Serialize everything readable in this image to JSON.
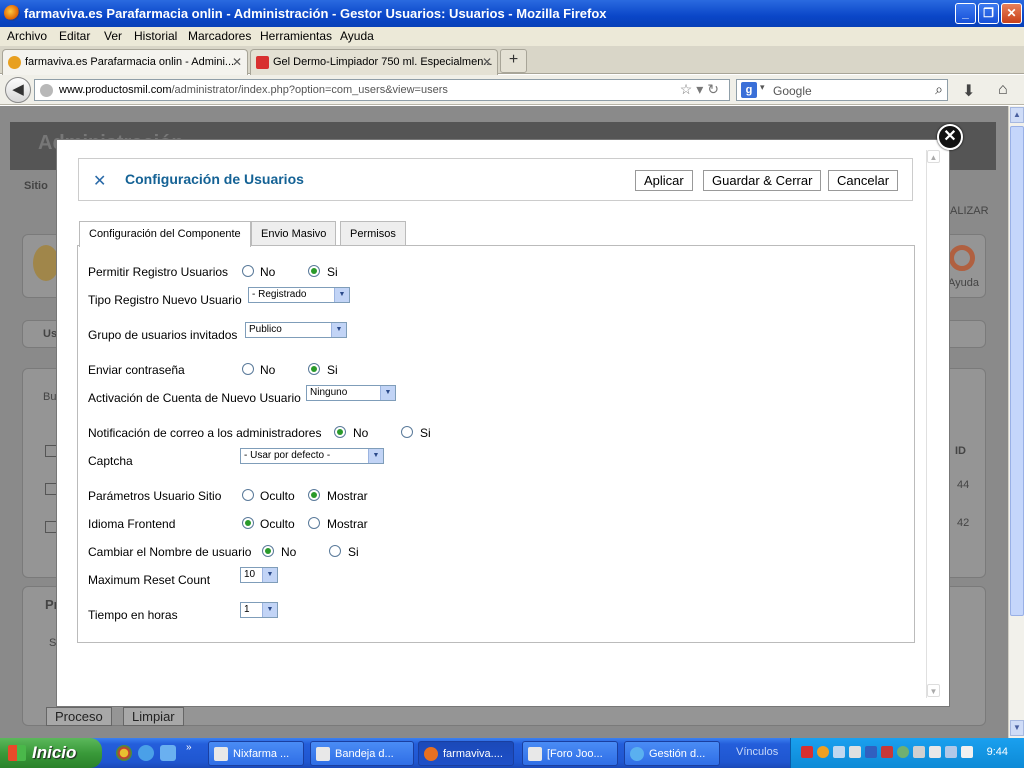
{
  "window": {
    "title": "farmaviva.es Parafarmacia onlin - Administración - Gestor Usuarios: Usuarios - Mozilla Firefox"
  },
  "menu": [
    "Archivo",
    "Editar",
    "Ver",
    "Historial",
    "Marcadores",
    "Herramientas",
    "Ayuda"
  ],
  "tabs": [
    {
      "label": "farmaviva.es Parafarmacia onlin - Admini..."
    },
    {
      "label": "Gel Dermo-Limpiador 750 ml. Especialmen..."
    }
  ],
  "nav": {
    "url_host": "www.productosmil.com",
    "url_path": "/administrator/index.php?option=com_users&view=users",
    "search_placeholder": "Google"
  },
  "background": {
    "header_title": "Administración",
    "sitio": "Sitio",
    "finalizar": "ALIZAR",
    "ayuda": "Ayuda",
    "us": "Us",
    "bu": "Bu",
    "id_col": "ID",
    "id1": "44",
    "id2": "42",
    "pr": "Pr",
    "s": "S",
    "proceso": "Proceso",
    "limpiar": "Limpiar"
  },
  "modal": {
    "title": "Configuración de Usuarios",
    "buttons": {
      "apply": "Aplicar",
      "save_close": "Guardar & Cerrar",
      "cancel": "Cancelar"
    },
    "tabs": [
      "Configuración del Componente",
      "Envio Masivo",
      "Permisos"
    ],
    "fields": {
      "permitir_registro": {
        "label": "Permitir Registro Usuarios",
        "opt1": "No",
        "opt2": "Si",
        "selected": "Si"
      },
      "tipo_registro": {
        "label": "Tipo Registro Nuevo Usuario",
        "value": "- Registrado"
      },
      "grupo_invitados": {
        "label": "Grupo de usuarios invitados",
        "value": "Publico"
      },
      "enviar_contrasena": {
        "label": "Enviar contraseña",
        "opt1": "No",
        "opt2": "Si",
        "selected": "Si"
      },
      "activacion_cuenta": {
        "label": "Activación de Cuenta de Nuevo Usuario",
        "value": "Ninguno"
      },
      "notificacion_admins": {
        "label": "Notificación de correo a los administradores",
        "opt1": "No",
        "opt2": "Si",
        "selected": "No"
      },
      "captcha": {
        "label": "Captcha",
        "value": "- Usar por defecto -"
      },
      "parametros_usuario": {
        "label": "Parámetros Usuario Sitio",
        "opt1": "Oculto",
        "opt2": "Mostrar",
        "selected": "Mostrar"
      },
      "idioma_frontend": {
        "label": "Idioma Frontend",
        "opt1": "Oculto",
        "opt2": "Mostrar",
        "selected": "Oculto"
      },
      "cambiar_nombre": {
        "label": "Cambiar el Nombre de usuario",
        "opt1": "No",
        "opt2": "Si",
        "selected": "No"
      },
      "max_reset": {
        "label": "Maximum Reset Count",
        "value": "10"
      },
      "tiempo_horas": {
        "label": "Tiempo en horas",
        "value": "1"
      }
    }
  },
  "taskbar": {
    "start": "Inicio",
    "tasks": [
      "Nixfarma ...",
      "Bandeja d...",
      "farmaviva....",
      "[Foro Joo...",
      "Gestión d..."
    ],
    "vinculos": "Vínculos",
    "clock": "9:44"
  },
  "colors": {
    "xp_blue": "#0a46c8",
    "accent_title": "#146295",
    "radio_checked": "#2a9a2a"
  }
}
